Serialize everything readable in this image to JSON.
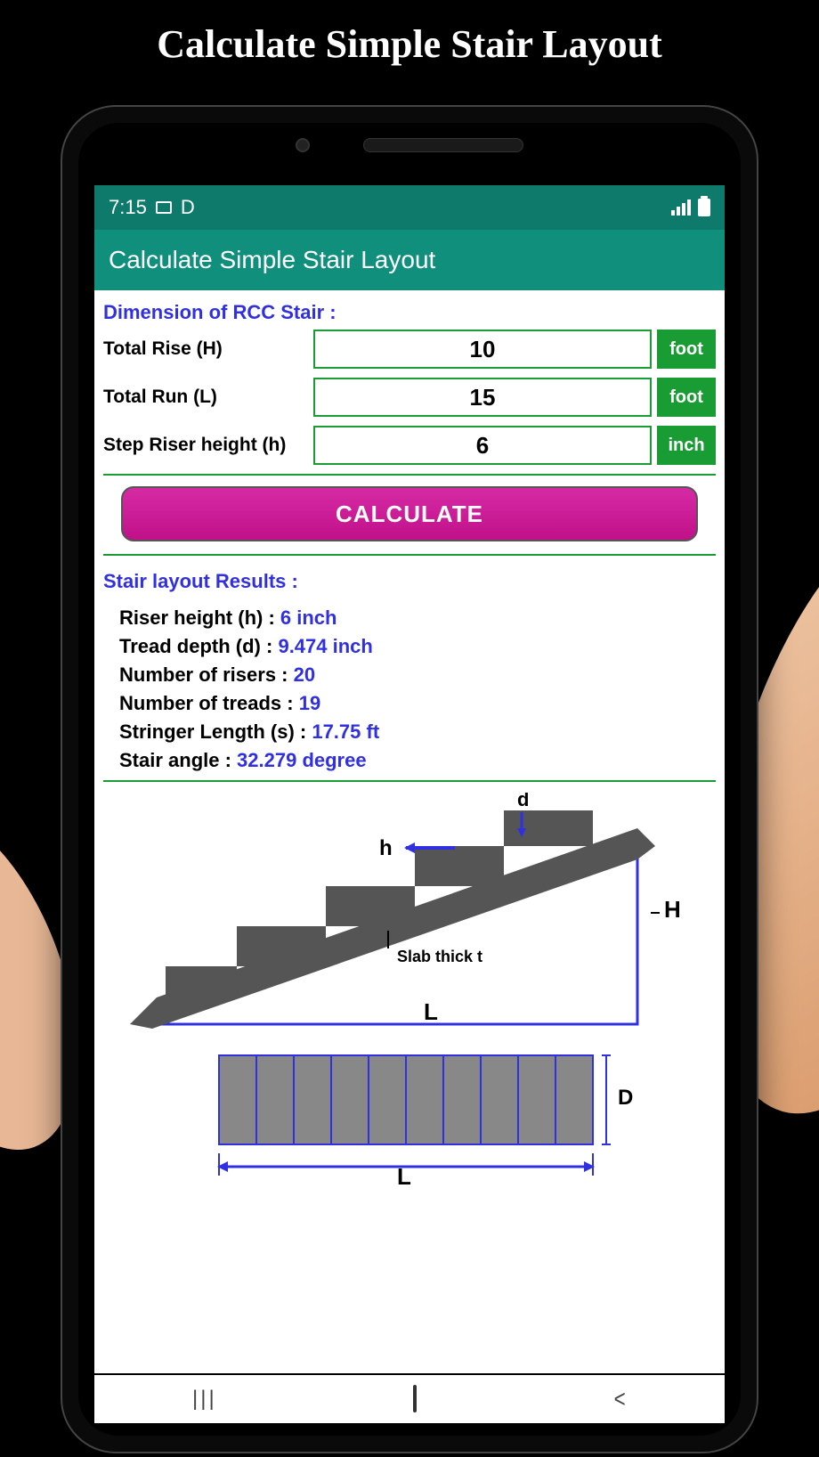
{
  "promo_title": "Calculate Simple Stair Layout",
  "status": {
    "time": "7:15",
    "indicator": "D"
  },
  "app_bar": {
    "title": "Calculate Simple Stair Layout"
  },
  "section1_title": "Dimension of RCC Stair :",
  "fields": {
    "rise": {
      "label": "Total Rise (H)",
      "value": "10",
      "unit": "foot"
    },
    "run": {
      "label": "Total Run (L)",
      "value": "15",
      "unit": "foot"
    },
    "riser_h": {
      "label": "Step Riser height (h)",
      "value": "6",
      "unit": "inch"
    }
  },
  "calculate_label": "CALCULATE",
  "results_title": "Stair layout Results :",
  "results": {
    "r1": {
      "label": "Riser height (h) : ",
      "value": "6 inch"
    },
    "r2": {
      "label": "Tread depth (d) : ",
      "value": "9.474 inch"
    },
    "r3": {
      "label": "Number of risers : ",
      "value": "20"
    },
    "r4": {
      "label": "Number of treads : ",
      "value": "19"
    },
    "r5": {
      "label": "Stringer Length (s) : ",
      "value": "17.75 ft"
    },
    "r6": {
      "label": "Stair angle : ",
      "value": "32.279 degree"
    }
  },
  "diagram": {
    "d": "d",
    "h": "h",
    "H": "H",
    "L": "L",
    "slab": "Slab thick t",
    "D": "D"
  }
}
